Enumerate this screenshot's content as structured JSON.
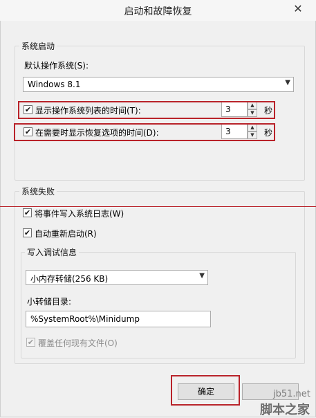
{
  "window": {
    "title": "启动和故障恢复",
    "close_glyph": "✕"
  },
  "startup": {
    "group_title": "系统启动",
    "default_os_label": "默认操作系统(S):",
    "default_os_value": "Windows 8.1",
    "show_os_list_label": "显示操作系统列表的时间(T):",
    "show_os_list_checked": true,
    "show_os_list_value": "3",
    "show_recovery_label": "在需要时显示恢复选项的时间(D):",
    "show_recovery_checked": true,
    "show_recovery_value": "3",
    "seconds_unit": "秒"
  },
  "failure": {
    "group_title": "系统失败",
    "write_event_label": "将事件写入系统日志(W)",
    "write_event_checked": true,
    "auto_restart_label": "自动重新启动(R)",
    "auto_restart_checked": true,
    "debug_group_title": "写入调试信息",
    "dump_type_value": "小内存转储(256 KB)",
    "dump_dir_label": "小转储目录:",
    "dump_dir_value": "%SystemRoot%\\Minidump",
    "overwrite_label": "覆盖任何现有文件(O)",
    "overwrite_checked": true,
    "overwrite_disabled": true
  },
  "buttons": {
    "ok_label": "确定"
  },
  "watermark": {
    "site": "jb51.net",
    "brand": "脚本之家"
  },
  "glyphs": {
    "check": "✔",
    "dropdown": "▼",
    "spin_up": "▲",
    "spin_down": "▼"
  }
}
